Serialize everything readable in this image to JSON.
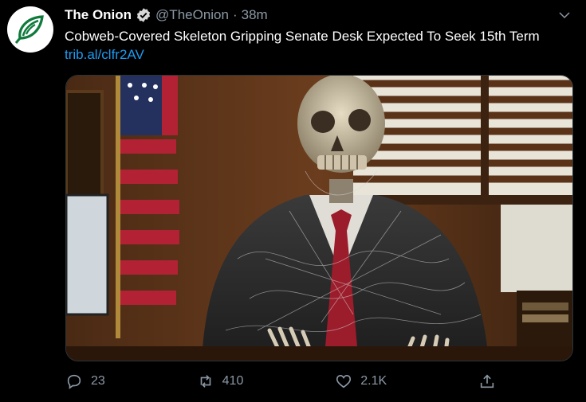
{
  "account": {
    "name": "The Onion",
    "handle": "@TheOnion",
    "separator": "·",
    "time": "38m"
  },
  "tweet": {
    "text": "Cobweb-Covered Skeleton Gripping Senate Desk Expected To Seek 15th Term",
    "link": "trib.al/clfr2AV"
  },
  "actions": {
    "replies": "23",
    "retweets": "410",
    "likes": "2.1K"
  },
  "colors": {
    "background": "#000000",
    "link": "#1d9bf0",
    "avatar_green": "#0f7a3c",
    "verified": "#d9d9d9"
  },
  "icons": [
    "onion-logo-icon",
    "verified-badge-icon",
    "chevron-down-icon",
    "reply-icon",
    "retweet-icon",
    "like-icon",
    "share-icon"
  ]
}
